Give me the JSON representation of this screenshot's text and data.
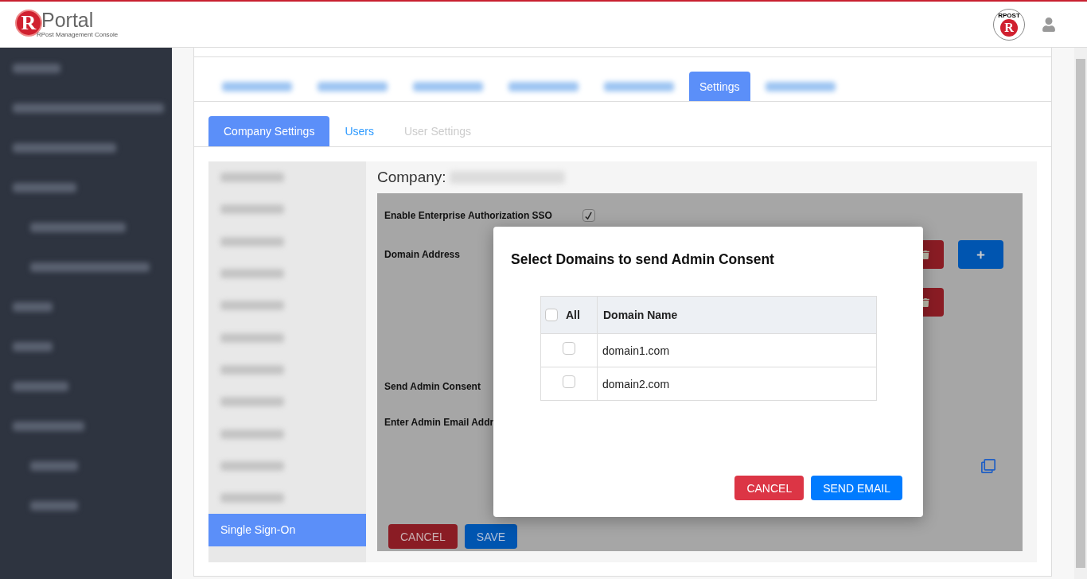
{
  "header": {
    "logo": {
      "letter": "R",
      "name": "Portal",
      "subtitle": "RPost Management Console"
    },
    "stamp": {
      "arc_text": "RPOST",
      "letter": "R"
    }
  },
  "tabs": [
    {
      "selected": false
    },
    {
      "selected": false
    },
    {
      "selected": false
    },
    {
      "selected": false
    },
    {
      "selected": false
    },
    {
      "label": "Settings",
      "selected": true
    },
    {
      "selected": false
    }
  ],
  "subtabs": [
    {
      "label": "Company Settings",
      "selected": true,
      "disabled": false
    },
    {
      "label": "Users",
      "selected": false,
      "disabled": false
    },
    {
      "label": "User Settings",
      "selected": false,
      "disabled": true
    }
  ],
  "settings_menu": [
    {
      "selected": false
    },
    {
      "selected": false
    },
    {
      "selected": false
    },
    {
      "selected": false
    },
    {
      "selected": false
    },
    {
      "selected": false
    },
    {
      "selected": false
    },
    {
      "selected": false
    },
    {
      "selected": false
    },
    {
      "selected": false
    },
    {
      "selected": false
    },
    {
      "label": "Single Sign-On",
      "selected": true
    }
  ],
  "company": {
    "label": "Company:"
  },
  "form": {
    "sso_label": "Enable Enterprise Authorization SSO",
    "sso_checked": true,
    "domain_label": "Domain Address",
    "domain_rows": [
      {
        "add": true
      },
      {
        "add": false
      }
    ],
    "consent_label": "Send Admin Consent",
    "email_label": "Enter Admin Email Addr",
    "buttons": [
      {
        "label": "CANCEL",
        "kind": "danger"
      },
      {
        "label": "SAVE",
        "kind": "primary"
      }
    ]
  },
  "dialog": {
    "title": "Select Domains to send Admin Consent",
    "table": {
      "select_all": {
        "label": "All",
        "checked": false
      },
      "column": "Domain Name",
      "rows": [
        {
          "domain": "domain1.com",
          "checked": false
        },
        {
          "domain": "domain2.com",
          "checked": false
        }
      ]
    },
    "buttons": [
      {
        "label": "CANCEL",
        "kind": "danger"
      },
      {
        "label": "SEND EMAIL",
        "kind": "primary"
      }
    ]
  }
}
